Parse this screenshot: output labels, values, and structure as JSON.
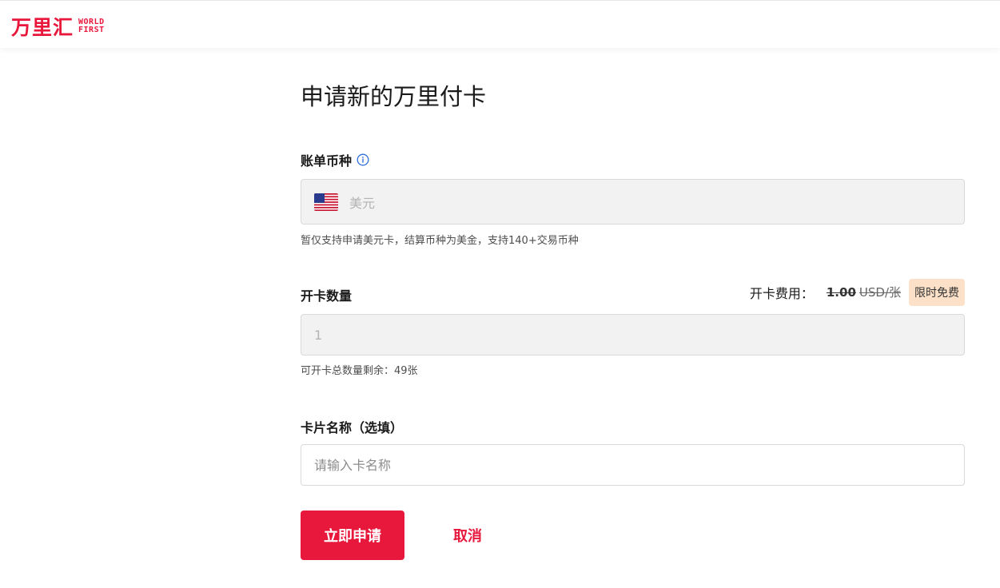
{
  "brand": {
    "name_cn": "万里汇",
    "name_en_line1": "WORLD",
    "name_en_line2": "FIRST",
    "accent_color": "#e8173c"
  },
  "page": {
    "title": "申请新的万里付卡"
  },
  "billing_currency": {
    "label": "账单币种",
    "info_icon": "info-circle-icon",
    "flag_icon": "us-flag-icon",
    "value": "美元",
    "hint": "暂仅支持申请美元卡，结算币种为美金，支持140+交易币种"
  },
  "card_quantity": {
    "label": "开卡数量",
    "fee_label": "开卡费用：",
    "fee_original_amount": "1.00",
    "fee_original_unit": "USD/张",
    "fee_badge": "限时免费",
    "badge_color": "#fce0c7",
    "value": "1",
    "hint": "可开卡总数量剩余：49张"
  },
  "card_name": {
    "label": "卡片名称（选填）",
    "placeholder": "请输入卡名称"
  },
  "actions": {
    "submit_label": "立即申请",
    "cancel_label": "取消"
  }
}
